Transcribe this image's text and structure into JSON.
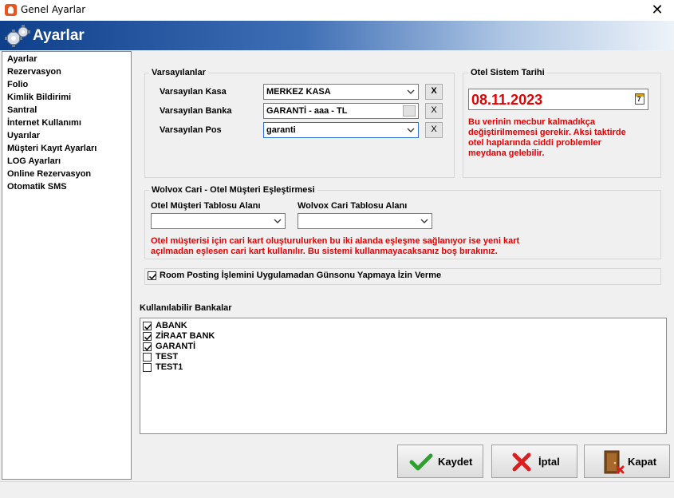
{
  "window": {
    "title": "Genel Ayarlar"
  },
  "header": {
    "title": "Ayarlar"
  },
  "sidebar": {
    "items": [
      "Ayarlar",
      "Rezervasyon",
      "Folio",
      "Kimlik Bildirimi",
      "Santral",
      "İnternet Kullanımı",
      "Uyarılar",
      "Müşteri Kayıt Ayarları",
      "LOG Ayarları",
      "Online Rezervasyon",
      "Otomatik SMS"
    ]
  },
  "defaults": {
    "title": "Varsayılanlar",
    "kasa_label": "Varsayılan Kasa",
    "kasa_value": "MERKEZ KASA",
    "banka_label": "Varsayılan Banka",
    "banka_value": "GARANTİ - aaa - TL",
    "pos_label": "Varsayılan Pos",
    "pos_value": "garanti",
    "clear_label": "X"
  },
  "system_date": {
    "title": "Otel Sistem Tarihi",
    "value": "08.11.2023",
    "calendar_day": "7",
    "warning_lines": [
      "Bu verinin mecbur kalmadıkça",
      "değiştirilmemesi gerekir. Aksi taktirde",
      "otel haplarında ciddi problemler",
      "meydana gelebilir."
    ]
  },
  "mapping": {
    "title": "Wolvox Cari - Otel Müşteri Eşleştirmesi",
    "left_label": "Otel Müşteri Tablosu Alanı",
    "left_value": "",
    "right_label": "Wolvox Cari Tablosu Alanı",
    "right_value": "",
    "warning_lines": [
      "Otel müşterisi için cari kart oluşturulurken bu iki alanda eşleşme sağlanıyor ise yeni kart",
      "açılmadan eşlesen cari kart kullanılır. Bu sistemi kullanmayacaksanız boş bırakınız."
    ]
  },
  "room_posting": {
    "label": "Room Posting İşlemini Uygulamadan Günsonu Yapmaya İzin Verme",
    "checked": true
  },
  "banks": {
    "title": "Kullanılabilir Bankalar",
    "items": [
      {
        "name": "ABANK",
        "checked": true
      },
      {
        "name": "ZİRAAT BANK",
        "checked": true
      },
      {
        "name": "GARANTİ",
        "checked": true
      },
      {
        "name": "TEST",
        "checked": false
      },
      {
        "name": "TEST1",
        "checked": false
      }
    ]
  },
  "buttons": {
    "save_label": "Kaydet",
    "cancel_label": "İptal",
    "close_label": "Kapat"
  },
  "colors": {
    "warning": "#e60000",
    "header_dark": "#0e3f8a",
    "check_green": "#2ea02e",
    "cancel_red": "#d91f1f"
  }
}
